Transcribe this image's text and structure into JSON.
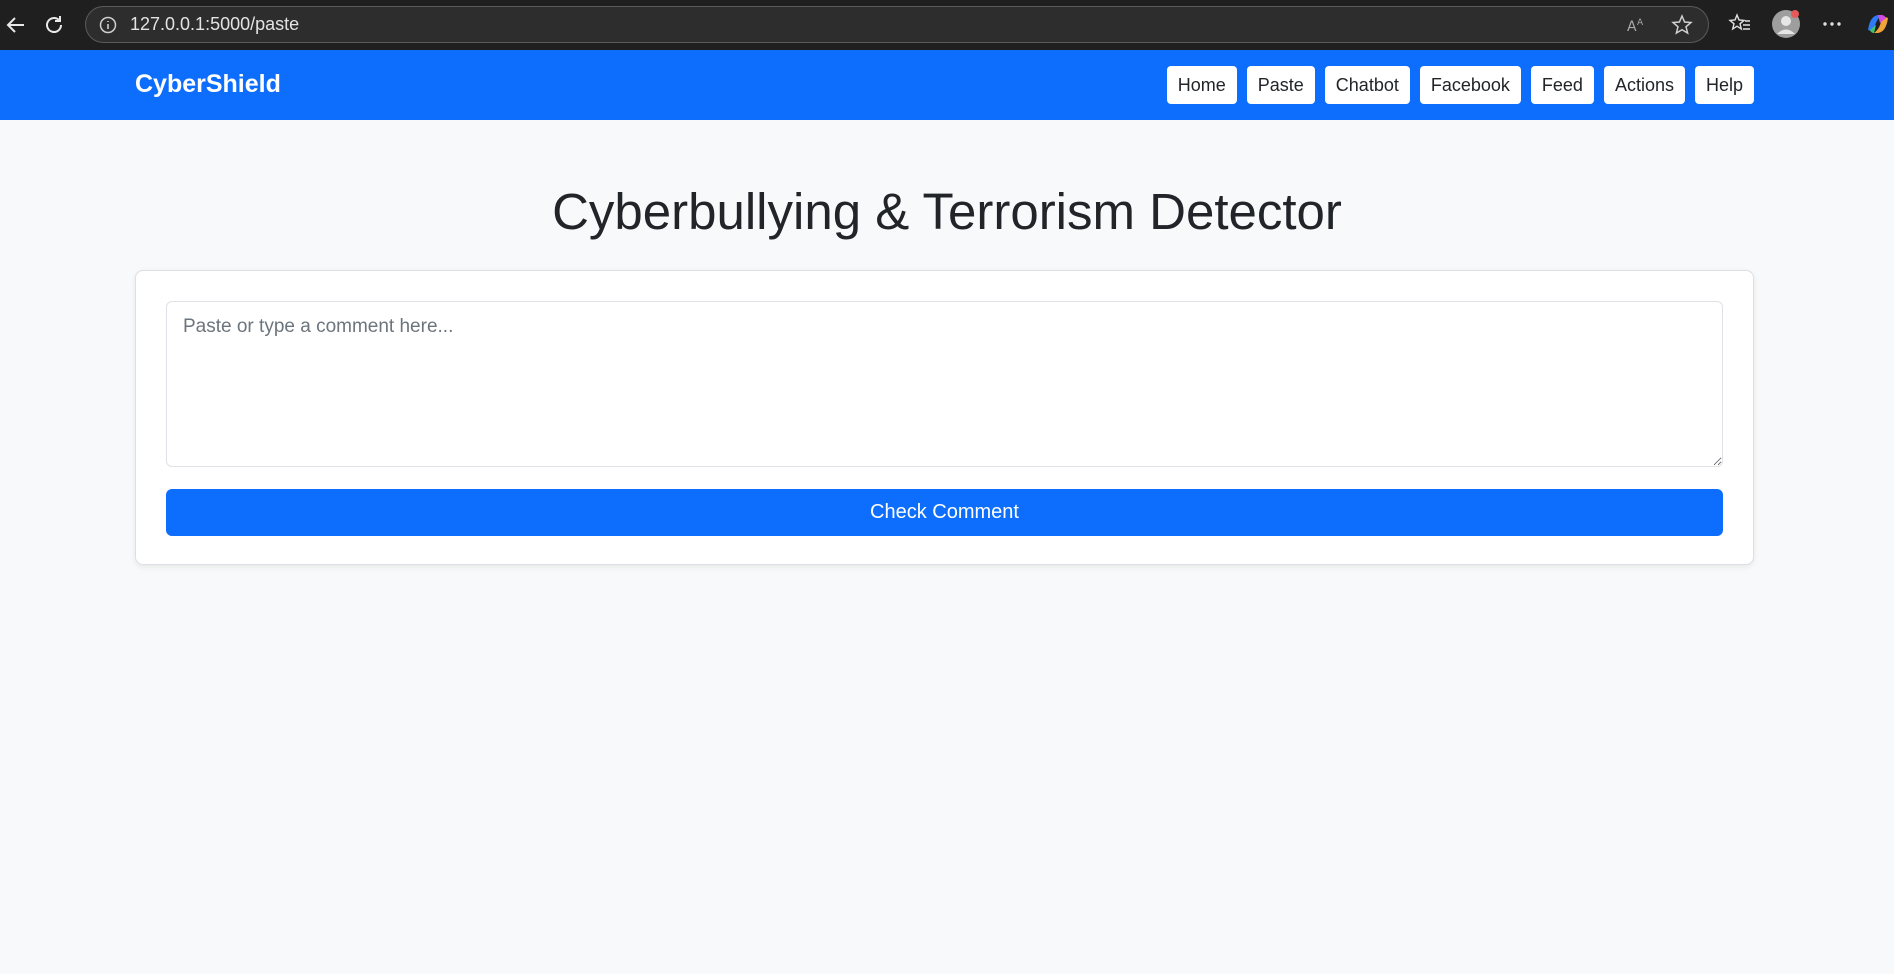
{
  "browser": {
    "url": "127.0.0.1:5000/paste"
  },
  "navbar": {
    "brand": "CyberShield",
    "links": [
      "Home",
      "Paste",
      "Chatbot",
      "Facebook",
      "Feed",
      "Actions",
      "Help"
    ]
  },
  "main": {
    "title": "Cyberbullying & Terrorism Detector",
    "comment_placeholder": "Paste or type a comment here...",
    "comment_value": "",
    "check_label": "Check Comment"
  },
  "colors": {
    "primary": "#0d6efd",
    "background": "#f8f9fa",
    "browser_chrome": "#1f1f1f"
  },
  "icons": [
    "back-arrow-icon",
    "reload-icon",
    "info-icon",
    "read-aloud-icon",
    "favorite-star-icon",
    "favorites-icon",
    "profile-avatar-icon",
    "more-menu-icon",
    "copilot-icon"
  ]
}
